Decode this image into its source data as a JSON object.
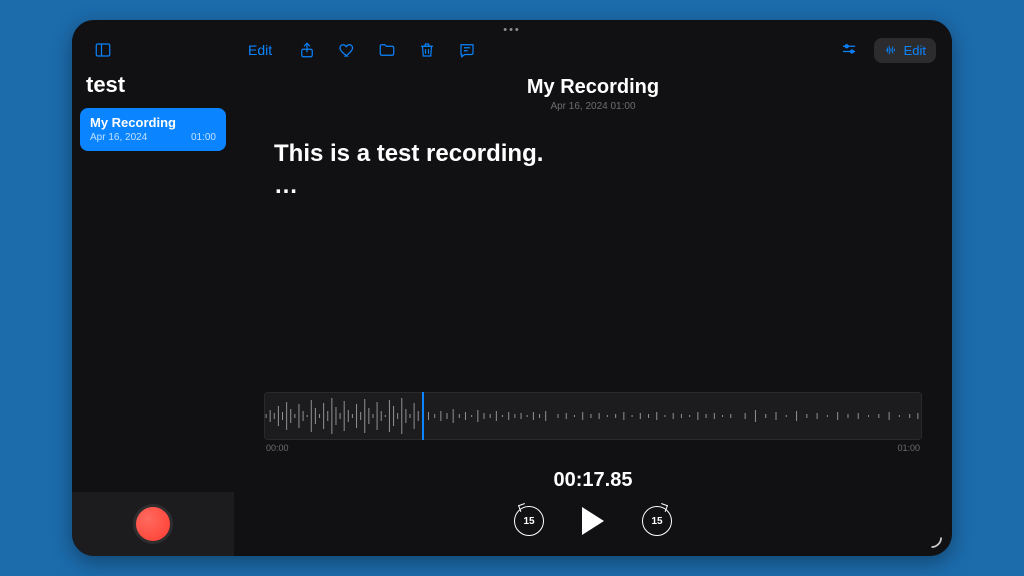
{
  "toolbar": {
    "edit_left": "Edit",
    "edit_right": "Edit"
  },
  "sidebar": {
    "title": "test",
    "items": [
      {
        "name": "My Recording",
        "date": "Apr 16, 2024",
        "duration": "01:00"
      }
    ]
  },
  "main": {
    "title": "My Recording",
    "subtitle": "Apr 16, 2024  01:00",
    "transcript_line": "This is a test recording.",
    "transcript_ellipsis": "…"
  },
  "playback": {
    "start_label": "00:00",
    "end_label": "01:00",
    "current_time": "00:17.85",
    "skip_back_label": "15",
    "skip_forward_label": "15"
  }
}
